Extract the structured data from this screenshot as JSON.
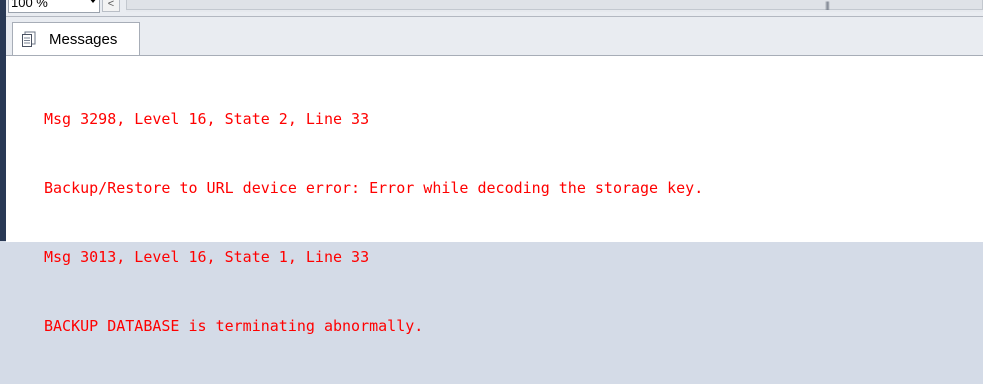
{
  "toolbar": {
    "zoom_value": "100 %",
    "scroll_left_glyph": "<",
    "scroll_grip_glyph": "|||"
  },
  "tabs": [
    {
      "label": "Messages",
      "icon": "messages-icon"
    }
  ],
  "messages": [
    "Msg 3298, Level 16, State 2, Line 33",
    "Backup/Restore to URL device error: Error while decoding the storage key.",
    "Msg 3013, Level 16, State 1, Line 33",
    "BACKUP DATABASE is terminating abnormally."
  ],
  "colors": {
    "error_text": "#ff0000",
    "left_strip": "#293955",
    "toolbar_bg": "#e9ecf1"
  }
}
